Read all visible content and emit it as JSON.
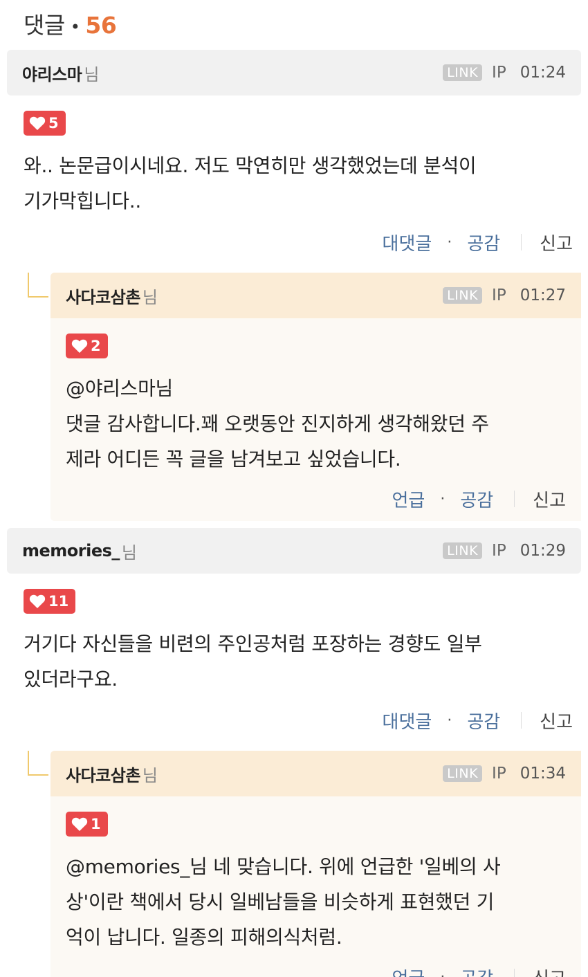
{
  "header": {
    "title": "댓글",
    "count": "56"
  },
  "comments": [
    {
      "author": "야리스마",
      "suffix": "님",
      "link": "LINK",
      "ip": "IP",
      "time": "01:24",
      "likes": "5",
      "text_lines": [
        "와.. 논문급이시네요. 저도 막연히만 생각했었는데 분석이",
        "기가막힙니다.."
      ],
      "actions": {
        "reply": "대댓글",
        "empathy": "공감",
        "report": "신고"
      },
      "reply": {
        "author": "사다코삼촌",
        "suffix": "님",
        "link": "LINK",
        "ip": "IP",
        "time": "01:27",
        "likes": "2",
        "mention": "@야리스마님",
        "text_lines": [
          "댓글 감사합니다.꽤 오랫동안 진지하게 생각해왔던 주",
          "제라 어디든 꼭 글을 남겨보고 싶었습니다."
        ],
        "actions": {
          "mention": "언급",
          "empathy": "공감",
          "report": "신고"
        }
      }
    },
    {
      "author": "memories_",
      "suffix": "님",
      "link": "LINK",
      "ip": "IP",
      "time": "01:29",
      "likes": "11",
      "text_lines": [
        "거기다 자신들을 비련의 주인공처럼 포장하는 경향도 일부",
        "있더라구요."
      ],
      "actions": {
        "reply": "대댓글",
        "empathy": "공감",
        "report": "신고"
      },
      "reply": {
        "author": "사다코삼촌",
        "suffix": "님",
        "link": "LINK",
        "ip": "IP",
        "time": "01:34",
        "likes": "1",
        "mention": "@memories_",
        "text_lines": [
          "님 네 맞습니다. 위에 언급한 '일베의 사",
          "상'이란 책에서 당시 일베남들을 비슷하게 표현했던 기",
          "억이 납니다. 일종의 피해의식처럼."
        ],
        "actions": {
          "mention": "언급",
          "empathy": "공감",
          "report": "신고"
        }
      }
    }
  ],
  "colors": {
    "accent": "#e8743b",
    "like": "#e9484a",
    "action": "#4a6f9c",
    "reply_bg": "#fcf9f4",
    "reply_head": "#fbecd6"
  },
  "icons": {
    "like": "heart-icon"
  }
}
